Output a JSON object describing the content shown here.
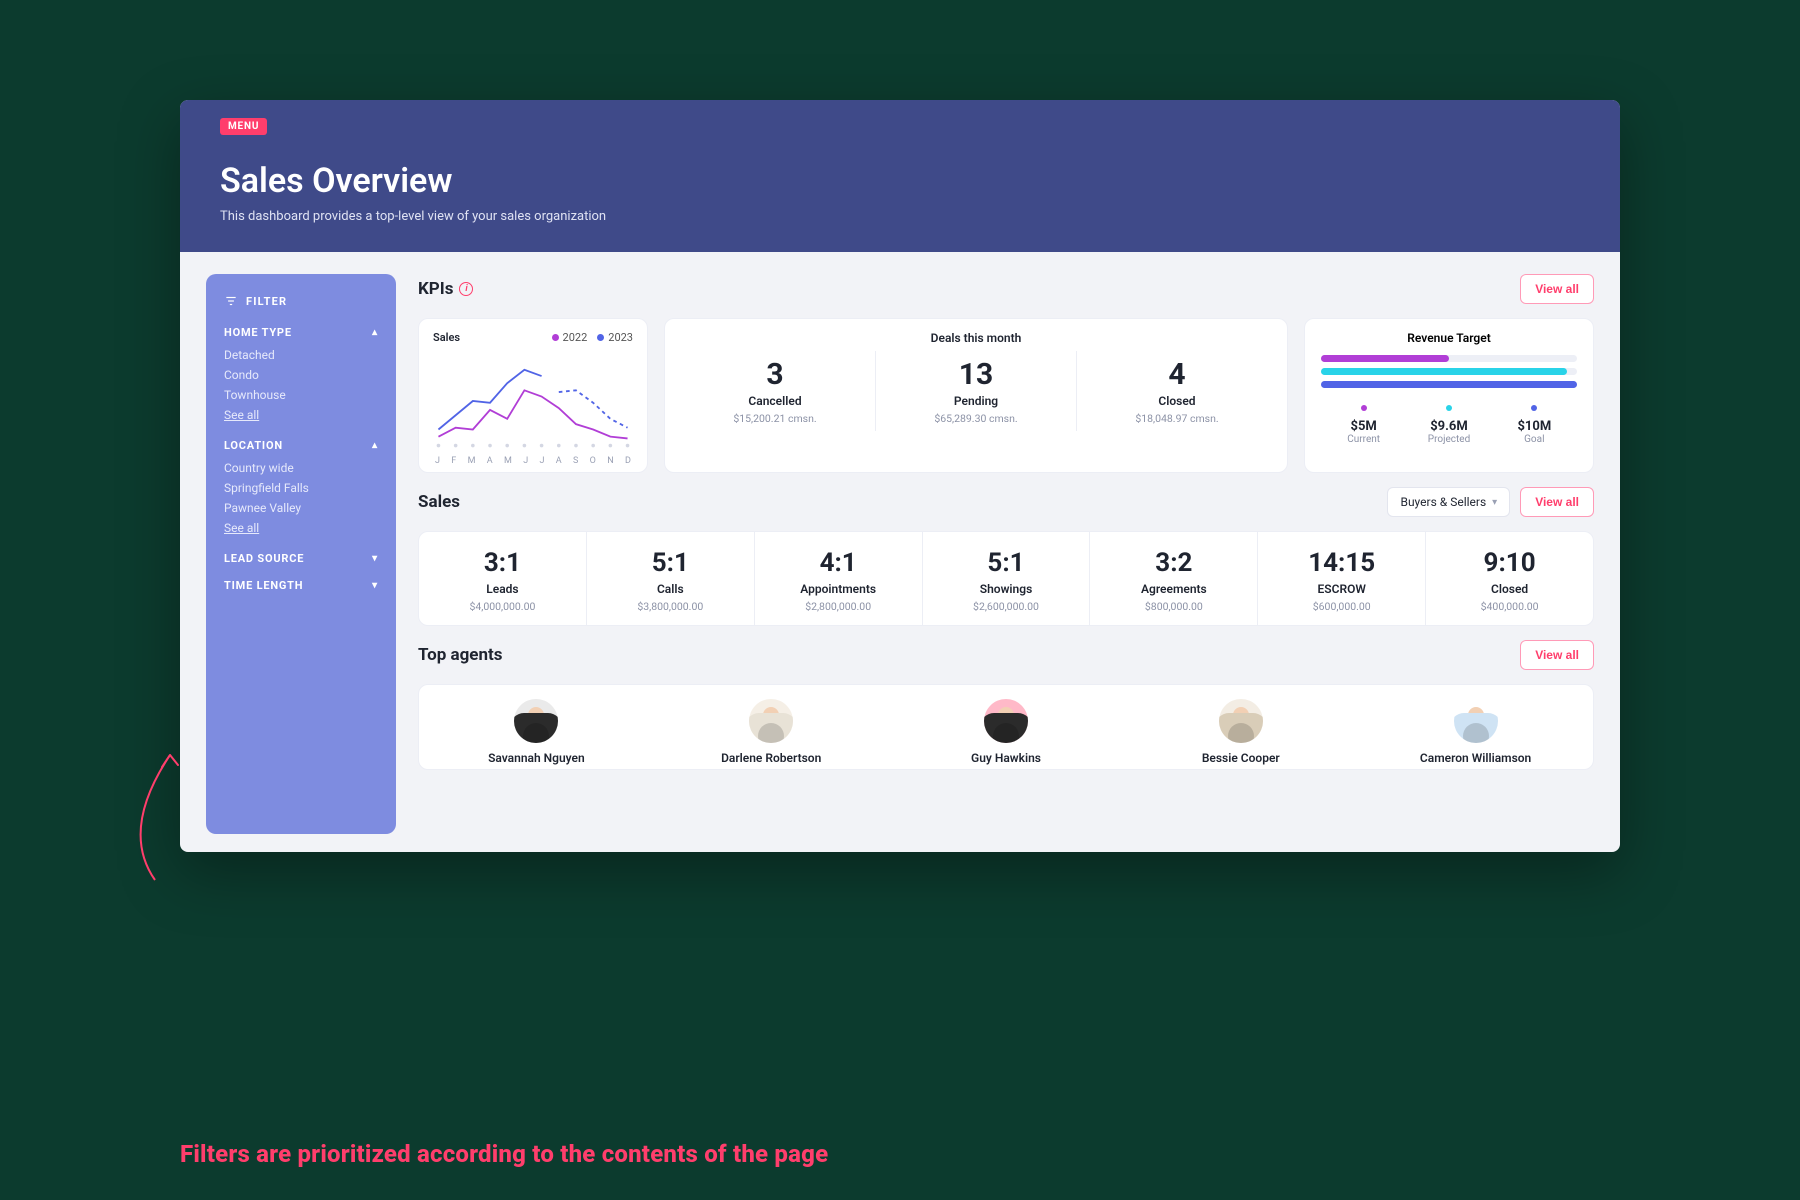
{
  "colors": {
    "accent": "#ff3e6c",
    "purple": "#b13ed6",
    "cyan": "#29d3e8",
    "indigo": "#5164e6"
  },
  "menu_chip": "MENU",
  "header": {
    "title": "Sales Overview",
    "subtitle": "This dashboard provides a top-level view of your sales organization"
  },
  "sidebar": {
    "filter_label": "FILTER",
    "groups": [
      {
        "title": "HOME TYPE",
        "expanded": true,
        "items": [
          "Detached",
          "Condo",
          "Townhouse"
        ],
        "see_all": "See all"
      },
      {
        "title": "LOCATION",
        "expanded": true,
        "items": [
          "Country wide",
          "Springfield Falls",
          "Pawnee Valley"
        ],
        "see_all": "See all"
      },
      {
        "title": "LEAD SOURCE",
        "expanded": false
      },
      {
        "title": "TIME LENGTH",
        "expanded": false
      }
    ]
  },
  "kpis": {
    "heading": "KPIs",
    "view_all": "View all",
    "sales_chart": {
      "title": "Sales",
      "legend": [
        {
          "label": "2022",
          "color": "#b13ed6"
        },
        {
          "label": "2023",
          "color": "#5164e6"
        }
      ],
      "months": [
        "J",
        "F",
        "M",
        "A",
        "M",
        "J",
        "J",
        "A",
        "S",
        "O",
        "N",
        "D"
      ]
    },
    "deals": {
      "title": "Deals this month",
      "items": [
        {
          "value": "3",
          "label": "Cancelled",
          "sub": "$15,200.21 cmsn."
        },
        {
          "value": "13",
          "label": "Pending",
          "sub": "$65,289.30 cmsn."
        },
        {
          "value": "4",
          "label": "Closed",
          "sub": "$18,048.97 cmsn."
        }
      ]
    },
    "revenue": {
      "title": "Revenue Target",
      "bars": [
        {
          "pct": 50,
          "color": "#b13ed6"
        },
        {
          "pct": 96,
          "color": "#29d3e8"
        },
        {
          "pct": 100,
          "color": "#5164e6"
        }
      ],
      "legend": [
        {
          "value": "$5M",
          "label": "Current",
          "color": "#b13ed6"
        },
        {
          "value": "$9.6M",
          "label": "Projected",
          "color": "#29d3e8"
        },
        {
          "value": "$10M",
          "label": "Goal",
          "color": "#5164e6"
        }
      ]
    }
  },
  "sales": {
    "heading": "Sales",
    "dropdown": "Buyers & Sellers",
    "view_all": "View all",
    "cells": [
      {
        "ratio": "3:1",
        "label": "Leads",
        "amount": "$4,000,000.00"
      },
      {
        "ratio": "5:1",
        "label": "Calls",
        "amount": "$3,800,000.00"
      },
      {
        "ratio": "4:1",
        "label": "Appointments",
        "amount": "$2,800,000.00"
      },
      {
        "ratio": "5:1",
        "label": "Showings",
        "amount": "$2,600,000.00"
      },
      {
        "ratio": "3:2",
        "label": "Agreements",
        "amount": "$800,000.00"
      },
      {
        "ratio": "14:15",
        "label": "ESCROW",
        "amount": "$600,000.00"
      },
      {
        "ratio": "9:10",
        "label": "Closed",
        "amount": "$400,000.00"
      }
    ]
  },
  "agents": {
    "heading": "Top agents",
    "view_all": "View all",
    "list": [
      {
        "name": "Savannah Nguyen",
        "bg": "#eaeaea",
        "shirt": "#2b2b2b"
      },
      {
        "name": "Darlene Robertson",
        "bg": "#f5efe6",
        "shirt": "#e8e2d6"
      },
      {
        "name": "Guy Hawkins",
        "bg": "#ffb9c8",
        "shirt": "#2b2b2b"
      },
      {
        "name": "Bessie Cooper",
        "bg": "#f3ede4",
        "shirt": "#d9cdb8"
      },
      {
        "name": "Cameron Williamson",
        "bg": "#ffffff",
        "shirt": "#cfe3f4"
      }
    ]
  },
  "chart_data": {
    "type": "line",
    "title": "Sales",
    "xlabel": "",
    "ylabel": "",
    "categories": [
      "J",
      "F",
      "M",
      "A",
      "M",
      "J",
      "J",
      "A",
      "S",
      "O",
      "N",
      "D"
    ],
    "ylim": [
      0,
      100
    ],
    "series": [
      {
        "name": "2022",
        "color": "#b13ed6",
        "values": [
          10,
          20,
          18,
          40,
          30,
          62,
          55,
          42,
          24,
          18,
          10,
          8
        ]
      },
      {
        "name": "2023",
        "color": "#5164e6",
        "values": [
          18,
          34,
          50,
          48,
          70,
          85,
          78,
          60,
          62,
          48,
          30,
          20
        ],
        "dashed_from_index": 7
      }
    ]
  },
  "annotation": "Filters are prioritized according to the contents of the page"
}
